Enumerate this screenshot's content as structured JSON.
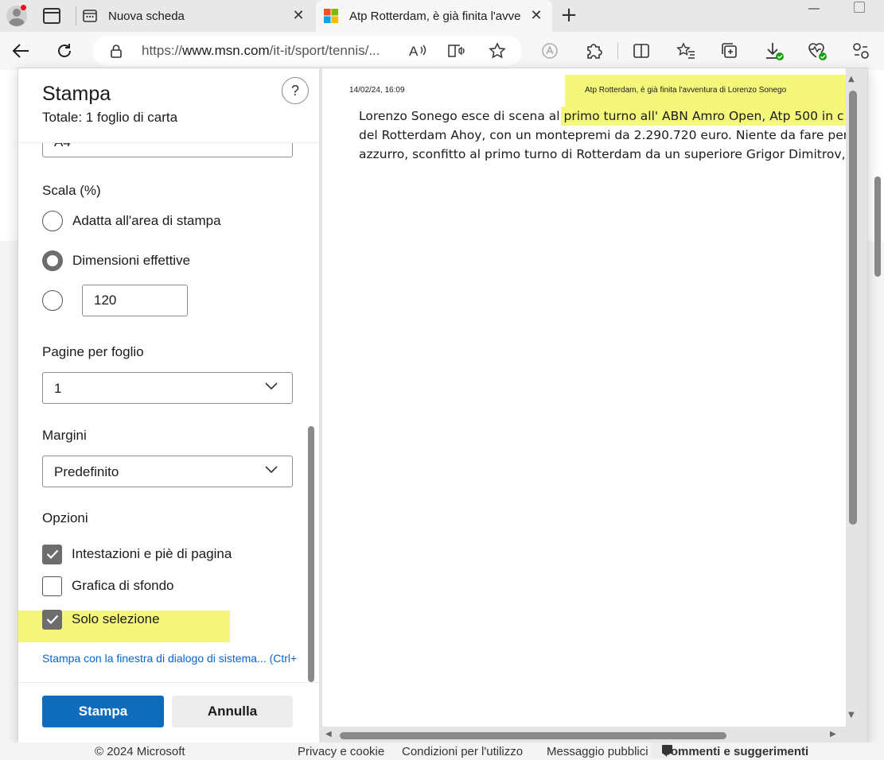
{
  "browser": {
    "tabs": [
      {
        "title": "Nuova scheda",
        "active": false
      },
      {
        "title": "Atp Rotterdam, è già finita l'avve",
        "active": true
      }
    ],
    "address": {
      "prefix": "https://",
      "host": "www.msn.com",
      "path": "/it-it/sport/tennis/..."
    }
  },
  "print_dialog": {
    "title": "Stampa",
    "total": "Totale: 1 foglio di carta",
    "help": "?",
    "paper_size_value": "A4",
    "scale": {
      "label": "Scala (%)",
      "options": [
        "Adatta all'area di stampa",
        "Dimensioni effettive"
      ],
      "selected": "Dimensioni effettive",
      "custom_value": "120"
    },
    "pages_per_sheet": {
      "label": "Pagine per foglio",
      "value": "1"
    },
    "margins": {
      "label": "Margini",
      "value": "Predefinito"
    },
    "options": {
      "label": "Opzioni",
      "items": [
        {
          "label": "Intestazioni e piè di pagina",
          "checked": true
        },
        {
          "label": "Grafica di sfondo",
          "checked": false
        },
        {
          "label": "Solo selezione",
          "checked": true
        }
      ]
    },
    "system_dialog_link": "Stampa con la finestra di dialogo di sistema... (Ctrl+",
    "print_button": "Stampa",
    "cancel_button": "Annulla"
  },
  "preview": {
    "date": "14/02/24, 16:09",
    "header_title": "Atp Rotterdam, è già finita l'avventura di Lorenzo Sonego",
    "body_lines": [
      "Lorenzo Sonego esce di scena al primo turno all' ABN Amro Open, Atp 500 in c",
      "del Rotterdam Ahoy, con un montepremi da 2.290.720 euro. Niente da fare per",
      "azzurro, sconfitto al primo turno di Rotterdam da un superiore Grigor Dimitrov,"
    ]
  },
  "footer": {
    "copyright": "© 2024 Microsoft",
    "links": [
      "Privacy e cookie",
      "Condizioni per l'utilizzo",
      "Messaggio pubblici"
    ],
    "feedback": "Commenti e suggerimenti"
  },
  "colors": {
    "accent": "#0f6cbd",
    "selection_highlight": "#f4f77a",
    "link": "#0a63c9"
  }
}
